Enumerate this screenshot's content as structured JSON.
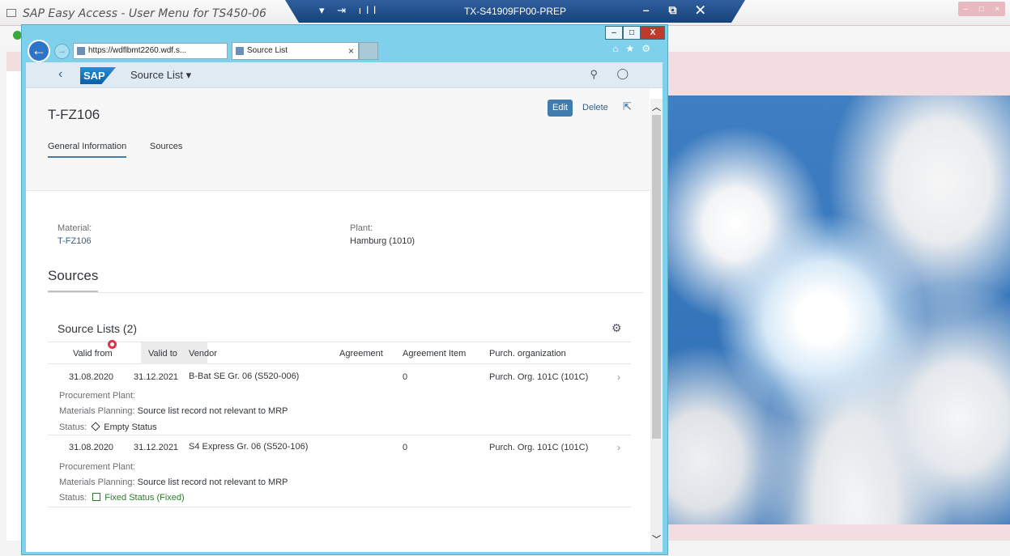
{
  "background": {
    "sapgui_title": "SAP Easy Access  -  User Menu for TS450-06",
    "rdp_title": "TX-S41909FP00-PREP"
  },
  "browser": {
    "url": "https://wdflbmt2260.wdf.s...",
    "tab_label": "Source List",
    "minimize_label": "–",
    "maximize_label": "□",
    "close_label": "X"
  },
  "shell": {
    "logo": "SAP",
    "app_title": "Source List ▾"
  },
  "object": {
    "title": "T-FZ106",
    "edit_label": "Edit",
    "delete_label": "Delete",
    "tabs": [
      "General Information",
      "Sources"
    ],
    "material_label": "Material:",
    "material_value": "T-FZ106",
    "plant_label": "Plant:",
    "plant_value": "Hamburg (1010)"
  },
  "sources": {
    "section_title": "Sources",
    "table_title": "Source Lists (2)",
    "columns": [
      "Valid from",
      "Valid to",
      "Vendor",
      "Agreement",
      "Agreement Item",
      "Purch. organization"
    ],
    "rows": [
      {
        "valid_from": "31.08.2020",
        "valid_to": "31.12.2021",
        "vendor": "B-Bat SE Gr. 06 (S520-006)",
        "agreement": "",
        "agreement_item": "0",
        "purch_org": "Purch. Org. 101C (101C)",
        "procurement_plant_label": "Procurement Plant:",
        "mrp_label": "Materials Planning:",
        "mrp_value": "Source list record not relevant to MRP",
        "status_label": "Status:",
        "status_value": "Empty Status"
      },
      {
        "valid_from": "31.08.2020",
        "valid_to": "31.12.2021",
        "vendor": "S4 Express Gr. 06 (S520-106)",
        "agreement": "",
        "agreement_item": "0",
        "purch_org": "Purch. Org. 101C (101C)",
        "procurement_plant_label": "Procurement Plant:",
        "mrp_label": "Materials Planning:",
        "mrp_value": "Source list record not relevant to MRP",
        "status_label": "Status:",
        "status_value": "Fixed Status (Fixed)"
      }
    ]
  },
  "colors": {
    "accent": "#427cac",
    "link": "#346187",
    "fixed_status": "#2b7d2b",
    "ie_frame": "#7fd0ea"
  }
}
